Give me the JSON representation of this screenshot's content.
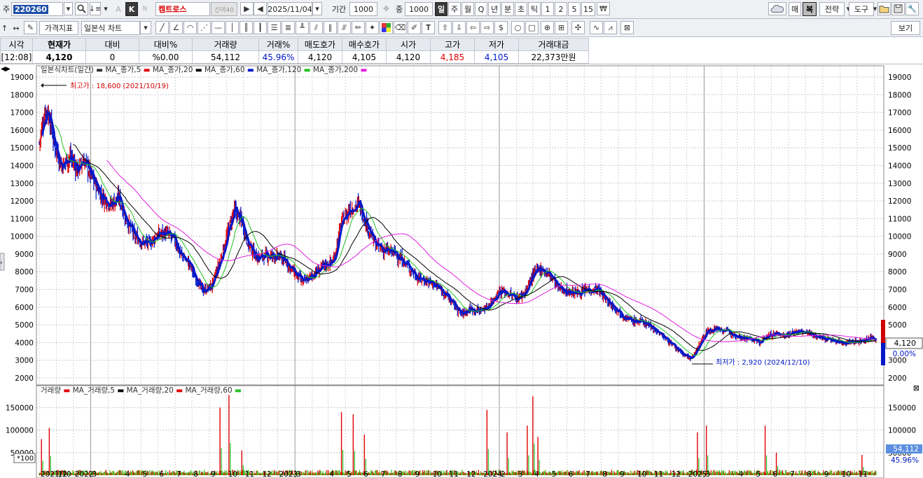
{
  "toolbar": {
    "stock_type_label": "주",
    "stock_code": "220260",
    "mode_a": "A",
    "mode_k": "K",
    "mode_n": "N",
    "stock_name": "켐트로스",
    "link_label": "신여40",
    "date": "2025/11/04",
    "period_label": "기간",
    "period_value": "1000",
    "middle_label": "중",
    "middle_value": "1000",
    "interval_day": "일",
    "interval_week": "주",
    "interval_month": "월",
    "interval_q": "Q",
    "interval_year": "년",
    "interval_min": "분",
    "interval_sec": "초",
    "interval_tick": "틱",
    "n1": "1",
    "n2": "2",
    "n5": "5",
    "n15": "15",
    "btn_buy": "매",
    "btn_copy": "복",
    "btn_strategy": "전략",
    "btn_tools": "도구",
    "indicator_dropdown": "가격지표",
    "chart_type_dropdown": "일본식 차트",
    "btn_view": "보기"
  },
  "quote": {
    "headers": [
      "시각",
      "현재가",
      "대비",
      "대비%",
      "거래량",
      "거래%",
      "매도호가",
      "매수호가",
      "시가",
      "고가",
      "저가",
      "거래대금"
    ],
    "values": [
      "[12:08]",
      "4,120",
      "0",
      "%0.00",
      "54,112",
      "45.96%",
      "4,120",
      "4,105",
      "4,120",
      "4,185",
      "4,105",
      "22,373만원"
    ]
  },
  "chart_data": [
    {
      "type": "candlestick",
      "legend": [
        "일본식차트(일간)",
        "MA_종가,5",
        "MA_종가,20",
        "MA_종가,60",
        "MA_종가,120",
        "MA_종가,200"
      ],
      "series_colors": {
        "up": "#e00000",
        "down": "#0018c8",
        "ma5": "#e00000",
        "ma20": "#000000",
        "ma60": "#0018c8",
        "ma120": "#22c022",
        "ma200": "#000000",
        "ma_pink": "#e020e0"
      },
      "y_ticks": [
        19000,
        18000,
        17000,
        16000,
        15000,
        14000,
        13000,
        12000,
        11000,
        10000,
        9000,
        8000,
        7000,
        6000,
        5000,
        4000,
        3000,
        2000
      ],
      "ylim": [
        2000,
        19000
      ],
      "x_tick_labels": [
        "2021/10",
        "12",
        "2022",
        "3",
        "4",
        "5",
        "6",
        "7",
        "8",
        "9",
        "10",
        "11",
        "12",
        "2023",
        "3",
        "4",
        "5",
        "6",
        "7",
        "8",
        "9",
        "10",
        "11",
        "12",
        "2024",
        "2",
        "3",
        "4",
        "5",
        "6",
        "7",
        "8",
        "9",
        "10",
        "11",
        "12",
        "2025",
        "3",
        "4",
        "5",
        "6",
        "7",
        "8",
        "9",
        "10",
        "11"
      ],
      "close_path": [
        [
          "2021-10-01",
          15300
        ],
        [
          "2021-10-12",
          17200
        ],
        [
          "2021-10-19",
          16800
        ],
        [
          "2021-10-28",
          15200
        ],
        [
          "2021-11-10",
          14000
        ],
        [
          "2021-11-25",
          14500
        ],
        [
          "2021-12-08",
          13800
        ],
        [
          "2021-12-20",
          14300
        ],
        [
          "2022-01-05",
          13200
        ],
        [
          "2022-01-20",
          12300
        ],
        [
          "2022-02-05",
          11800
        ],
        [
          "2022-02-20",
          12200
        ],
        [
          "2022-03-05",
          11000
        ],
        [
          "2022-03-20",
          10000
        ],
        [
          "2022-04-01",
          9700
        ],
        [
          "2022-04-15",
          9600
        ],
        [
          "2022-05-01",
          10100
        ],
        [
          "2022-05-15",
          10200
        ],
        [
          "2022-05-30",
          9800
        ],
        [
          "2022-06-10",
          9000
        ],
        [
          "2022-06-25",
          8500
        ],
        [
          "2022-07-05",
          7800
        ],
        [
          "2022-07-20",
          6900
        ],
        [
          "2022-08-05",
          7200
        ],
        [
          "2022-08-20",
          8600
        ],
        [
          "2022-09-05",
          10500
        ],
        [
          "2022-09-15",
          11500
        ],
        [
          "2022-09-28",
          10800
        ],
        [
          "2022-10-10",
          9500
        ],
        [
          "2022-10-25",
          8800
        ],
        [
          "2022-11-10",
          8900
        ],
        [
          "2022-11-30",
          8900
        ],
        [
          "2022-12-15",
          8600
        ],
        [
          "2023-01-01",
          7900
        ],
        [
          "2023-01-15",
          7400
        ],
        [
          "2023-02-01",
          7800
        ],
        [
          "2023-02-20",
          8300
        ],
        [
          "2023-03-10",
          8600
        ],
        [
          "2023-03-25",
          10800
        ],
        [
          "2023-04-10",
          11600
        ],
        [
          "2023-04-25",
          11800
        ],
        [
          "2023-05-10",
          10600
        ],
        [
          "2023-05-25",
          9500
        ],
        [
          "2023-06-10",
          9200
        ],
        [
          "2023-06-25",
          9100
        ],
        [
          "2023-07-10",
          8700
        ],
        [
          "2023-07-25",
          8200
        ],
        [
          "2023-08-10",
          7600
        ],
        [
          "2023-08-25",
          7500
        ],
        [
          "2023-09-10",
          7200
        ],
        [
          "2023-09-25",
          6800
        ],
        [
          "2023-10-10",
          6200
        ],
        [
          "2023-10-25",
          5600
        ],
        [
          "2023-11-10",
          5900
        ],
        [
          "2023-11-25",
          5800
        ],
        [
          "2023-12-10",
          6000
        ],
        [
          "2024-01-01",
          6900
        ],
        [
          "2024-01-15",
          6800
        ],
        [
          "2024-02-01",
          6500
        ],
        [
          "2024-02-15",
          6800
        ],
        [
          "2024-03-01",
          7800
        ],
        [
          "2024-03-15",
          8200
        ],
        [
          "2024-04-01",
          7800
        ],
        [
          "2024-04-15",
          7100
        ],
        [
          "2024-05-01",
          6900
        ],
        [
          "2024-05-20",
          6800
        ],
        [
          "2024-06-10",
          7000
        ],
        [
          "2024-06-25",
          7000
        ],
        [
          "2024-07-10",
          6400
        ],
        [
          "2024-07-25",
          6000
        ],
        [
          "2024-08-10",
          5500
        ],
        [
          "2024-08-25",
          5200
        ],
        [
          "2024-09-10",
          5200
        ],
        [
          "2024-09-25",
          5000
        ],
        [
          "2024-10-10",
          4600
        ],
        [
          "2024-10-25",
          4200
        ],
        [
          "2024-11-10",
          3700
        ],
        [
          "2024-11-25",
          3300
        ],
        [
          "2024-12-10",
          3100
        ],
        [
          "2024-12-20",
          3700
        ],
        [
          "2025-01-05",
          4600
        ],
        [
          "2025-01-20",
          4800
        ],
        [
          "2025-02-05",
          4700
        ],
        [
          "2025-02-20",
          4500
        ],
        [
          "2025-03-10",
          4300
        ],
        [
          "2025-03-25",
          4200
        ],
        [
          "2025-04-10",
          4000
        ],
        [
          "2025-04-25",
          4400
        ],
        [
          "2025-05-10",
          4500
        ],
        [
          "2025-05-25",
          4400
        ],
        [
          "2025-06-10",
          4600
        ],
        [
          "2025-06-25",
          4600
        ],
        [
          "2025-07-10",
          4500
        ],
        [
          "2025-07-25",
          4300
        ],
        [
          "2025-08-10",
          4200
        ],
        [
          "2025-08-25",
          4050
        ],
        [
          "2025-09-10",
          4000
        ],
        [
          "2025-09-25",
          4050
        ],
        [
          "2025-10-10",
          4100
        ],
        [
          "2025-10-25",
          4250
        ],
        [
          "2025-11-04",
          4120
        ]
      ],
      "annotations": {
        "high": "최고가 : 18,600 (2021/10/19)",
        "low": "최저가 : 2,920 (2024/12/10)"
      },
      "last_price_label": "4,120",
      "change_label": "0.00%",
      "right_axis_labels": {
        "r5000": "5000",
        "r3000": "3000"
      },
      "legend_place": "top-left",
      "grid": true
    },
    {
      "type": "bar",
      "legend": [
        "거래량",
        "MA_거래량,5",
        "MA_거래량,20",
        "MA_거래량,60"
      ],
      "y_ticks": [
        150000,
        100000,
        50000
      ],
      "ylim": [
        0,
        180000
      ],
      "unit_label": "*100",
      "volume_spikes": [
        [
          "2021-10-05",
          80000
        ],
        [
          "2021-10-19",
          105000
        ],
        [
          "2022-08-20",
          150000
        ],
        [
          "2022-09-05",
          178000
        ],
        [
          "2022-09-28",
          55000
        ],
        [
          "2023-03-25",
          140000
        ],
        [
          "2023-04-15",
          135000
        ],
        [
          "2023-05-05",
          90000
        ],
        [
          "2023-12-10",
          145000
        ],
        [
          "2024-01-15",
          95000
        ],
        [
          "2024-02-20",
          110000
        ],
        [
          "2024-03-01",
          175000
        ],
        [
          "2024-03-10",
          85000
        ],
        [
          "2024-12-20",
          95000
        ],
        [
          "2025-01-05",
          110000
        ],
        [
          "2025-04-20",
          110000
        ],
        [
          "2025-05-10",
          50000
        ],
        [
          "2025-10-10",
          45000
        ]
      ],
      "last_volume_label": "54,112",
      "last_pct_label": "45.96%",
      "close_button": "⊠"
    }
  ]
}
